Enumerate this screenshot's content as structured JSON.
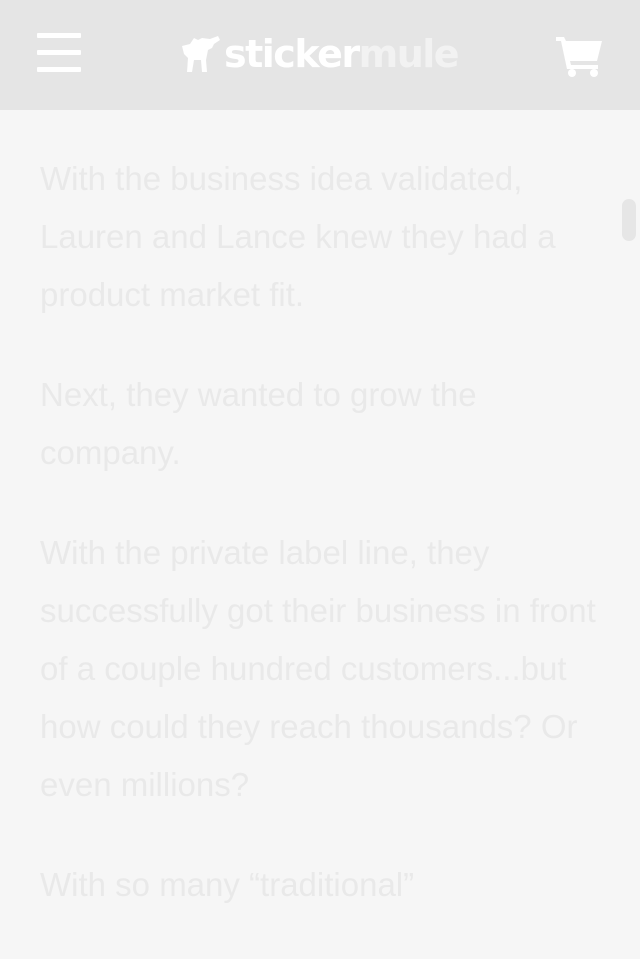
{
  "header": {
    "menu_icon": "hamburger-menu-icon",
    "logo": {
      "part1": "sticker",
      "part2": "mule",
      "icon": "mule-logo-icon"
    },
    "cart_icon": "shopping-cart-icon",
    "background": "#e5e5e5"
  },
  "article": {
    "paragraphs": [
      "With the business idea validated, Lauren and Lance knew they had a product market fit.",
      "Next, they wanted to grow the company.",
      "With the private label line, they successfully got their business in front of a couple hundred customers...but how could they reach thousands? Or even millions?",
      "With so many “traditional”"
    ],
    "text_color": "#e9e9e9"
  },
  "scrollbar": {
    "color": "#e6e6e6"
  }
}
